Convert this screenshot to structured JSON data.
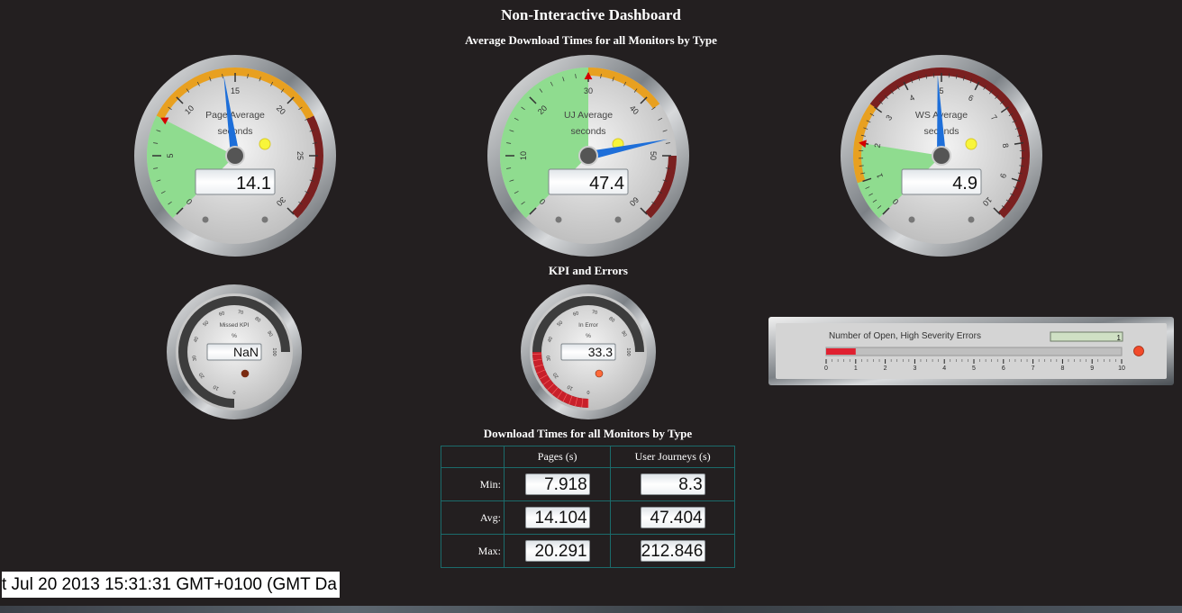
{
  "dashboard": {
    "title": "Non-Interactive Dashboard",
    "section_avg": "Average Download Times for all Monitors by Type",
    "section_kpi": "KPI and Errors",
    "section_dl": "Download Times for all Monitors by Type"
  },
  "gauges": {
    "page": {
      "label1": "Page Average",
      "label2": "seconds",
      "value": "14.1",
      "reading": 14.1,
      "min": 0,
      "max": 30,
      "ticks": [
        "0",
        "5",
        "10",
        "15",
        "20",
        "25",
        "30"
      ]
    },
    "uj": {
      "label1": "UJ Average",
      "label2": "seconds",
      "value": "47.4",
      "reading": 47.4,
      "min": 0,
      "max": 60,
      "ticks": [
        "0",
        "10",
        "20",
        "30",
        "40",
        "50",
        "60"
      ]
    },
    "ws": {
      "label1": "WS Average",
      "label2": "seconds",
      "value": "4.9",
      "reading": 4.9,
      "min": 0,
      "max": 10,
      "ticks": [
        "0",
        "1",
        "2",
        "3",
        "4",
        "5",
        "6",
        "7",
        "8",
        "9",
        "10"
      ]
    }
  },
  "kpi": {
    "missed": {
      "label1": "Missed KPI",
      "label2": "%",
      "value": "NaN",
      "ticks": [
        "0",
        "10",
        "20",
        "30",
        "40",
        "50",
        "60",
        "70",
        "80",
        "90",
        "100"
      ]
    },
    "error": {
      "label1": "In Error",
      "label2": "%",
      "value": "33.3",
      "reading": 33.3,
      "ticks": [
        "0",
        "10",
        "20",
        "30",
        "40",
        "50",
        "60",
        "70",
        "80",
        "90",
        "100"
      ]
    }
  },
  "errors_bar": {
    "label": "Number of Open, High Severity Errors",
    "value": "1",
    "reading": 1,
    "ticks": [
      "0",
      "1",
      "2",
      "3",
      "4",
      "5",
      "6",
      "7",
      "8",
      "9",
      "10"
    ]
  },
  "download_table": {
    "headers": [
      "Pages (s)",
      "User Journeys (s)"
    ],
    "rows": [
      {
        "label": "Min:",
        "pages": "7.918",
        "uj": "8.3"
      },
      {
        "label": "Avg:",
        "pages": "14.104",
        "uj": "47.404"
      },
      {
        "label": "Max:",
        "pages": "20.291",
        "uj": "212.846"
      }
    ]
  },
  "ticker": {
    "text": "t Jul 20 2013 15:31:31 GMT+0100 (GMT Da"
  },
  "colors": {
    "background": "#231f20",
    "needle": "#1e6fd9",
    "green_zone": "#8fdc8f",
    "orange_zone": "#e8a020",
    "red_zone": "#7a2020",
    "table_border": "#1b6b6b"
  }
}
